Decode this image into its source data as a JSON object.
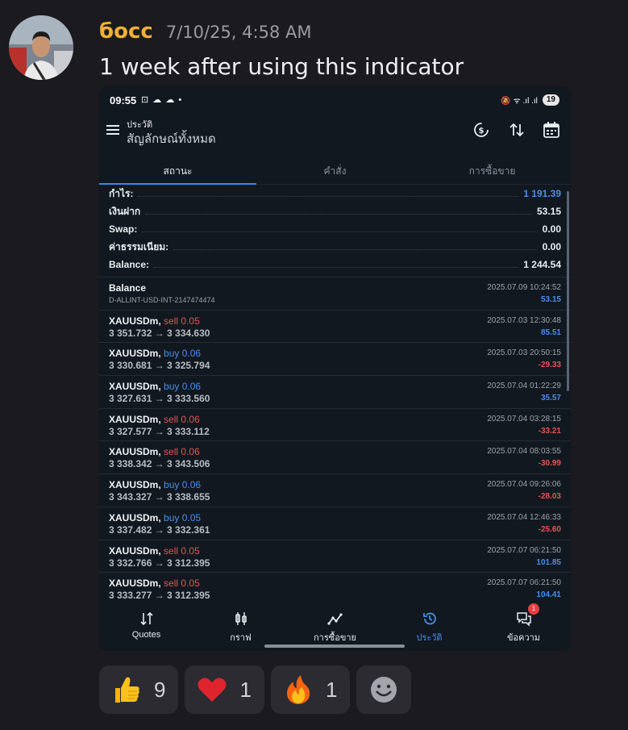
{
  "message": {
    "username": "босс",
    "timestamp": "7/10/25, 4:58 AM",
    "text": "1 week after using this indicator"
  },
  "phone": {
    "statusbar": {
      "time": "09:55",
      "left_icons": "⊡ ☁ ☁ •",
      "right_icons": "🔕 ᯤ .ıl .ıl",
      "battery": "19"
    },
    "appbar": {
      "title_small": "ประวัติ",
      "title_main": "สัญลักษณ์ทั้งหมด"
    },
    "tabs": [
      {
        "label": "สถานะ",
        "active": true
      },
      {
        "label": "คำสั่ง",
        "active": false
      },
      {
        "label": "การซื้อขาย",
        "active": false
      }
    ],
    "summary": [
      {
        "label": "กำไร:",
        "value": "1 191.39",
        "color": "#4a8eea"
      },
      {
        "label": "เงินฝาก",
        "value": "53.15"
      },
      {
        "label": "Swap:",
        "value": "0.00"
      },
      {
        "label": "ค่าธรรมเนียม:",
        "value": "0.00"
      },
      {
        "label": "Balance:",
        "value": "1 244.54"
      }
    ],
    "balance_entry": {
      "title": "Balance",
      "sub": "D-ALLINT-USD-INT-2147474474",
      "time": "2025.07.09 10:24:52",
      "profit": "53.15"
    },
    "deals": [
      {
        "symbol": "XAUUSDm,",
        "side": "sell",
        "volume": "0.05",
        "prices": "3 351.732 → 3 334.630",
        "time": "2025.07.03 12:30:48",
        "profit": "85.51",
        "positive": true
      },
      {
        "symbol": "XAUUSDm,",
        "side": "buy",
        "volume": "0.06",
        "prices": "3 330.681 → 3 325.794",
        "time": "2025.07.03 20:50:15",
        "profit": "-29.33",
        "positive": false
      },
      {
        "symbol": "XAUUSDm,",
        "side": "buy",
        "volume": "0.06",
        "prices": "3 327.631 → 3 333.560",
        "time": "2025.07.04 01:22:29",
        "profit": "35.57",
        "positive": true
      },
      {
        "symbol": "XAUUSDm,",
        "side": "sell",
        "volume": "0.06",
        "prices": "3 327.577 → 3 333.112",
        "time": "2025.07.04 03:28:15",
        "profit": "-33.21",
        "positive": false
      },
      {
        "symbol": "XAUUSDm,",
        "side": "sell",
        "volume": "0.06",
        "prices": "3 338.342 → 3 343.506",
        "time": "2025.07.04 08:03:55",
        "profit": "-30.99",
        "positive": false
      },
      {
        "symbol": "XAUUSDm,",
        "side": "buy",
        "volume": "0.06",
        "prices": "3 343.327 → 3 338.655",
        "time": "2025.07.04 09:26:06",
        "profit": "-28.03",
        "positive": false
      },
      {
        "symbol": "XAUUSDm,",
        "side": "buy",
        "volume": "0.05",
        "prices": "3 337.482 → 3 332.361",
        "time": "2025.07.04 12:46:33",
        "profit": "-25.60",
        "positive": false
      },
      {
        "symbol": "XAUUSDm,",
        "side": "sell",
        "volume": "0.05",
        "prices": "3 332.766 → 3 312.395",
        "time": "2025.07.07 06:21:50",
        "profit": "101.85",
        "positive": true
      },
      {
        "symbol": "XAUUSDm,",
        "side": "sell",
        "volume": "0.05",
        "prices": "3 333.277 → 3 312.395",
        "time": "2025.07.07 06:21:50",
        "profit": "104.41",
        "positive": true
      }
    ],
    "bottomnav": [
      {
        "label": "Quotes",
        "icon": "quotes-icon",
        "active": false
      },
      {
        "label": "กราฟ",
        "icon": "chart-icon",
        "active": false
      },
      {
        "label": "การซื้อขาย",
        "icon": "trade-icon",
        "active": false
      },
      {
        "label": "ประวัติ",
        "icon": "history-icon",
        "active": true
      },
      {
        "label": "ข้อความ",
        "icon": "messages-icon",
        "active": false,
        "badge": "1"
      }
    ]
  },
  "reactions": [
    {
      "emoji": "thumbs-up",
      "count": "9"
    },
    {
      "emoji": "heart",
      "count": "1"
    },
    {
      "emoji": "fire",
      "count": "1"
    }
  ],
  "colors": {
    "username": "#f0b132",
    "profit_positive": "#4a8eea",
    "profit_negative": "#e55454",
    "active_tab": "#3d86e6"
  }
}
